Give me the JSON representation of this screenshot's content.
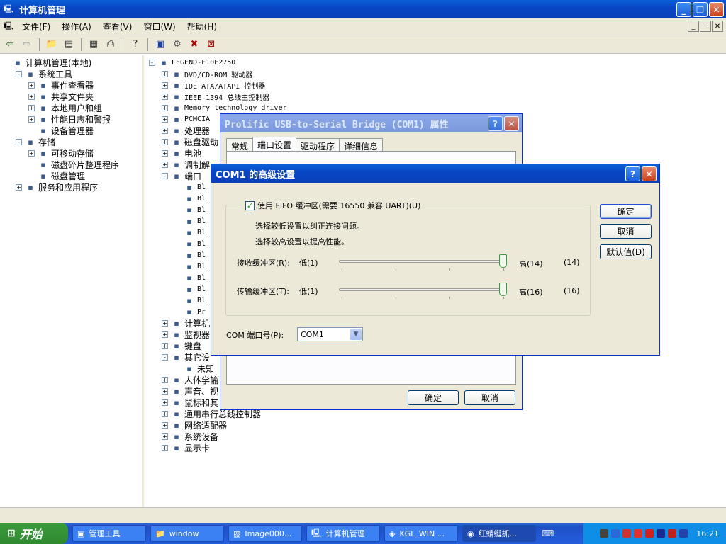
{
  "window": {
    "title": "计算机管理"
  },
  "menu": [
    "文件(F)",
    "操作(A)",
    "查看(V)",
    "窗口(W)",
    "帮助(H)"
  ],
  "left_tree": [
    {
      "label": "计算机管理(本地)",
      "depth": 0,
      "exp": ""
    },
    {
      "label": "系统工具",
      "depth": 1,
      "exp": "-"
    },
    {
      "label": "事件查看器",
      "depth": 2,
      "exp": "+"
    },
    {
      "label": "共享文件夹",
      "depth": 2,
      "exp": "+"
    },
    {
      "label": "本地用户和组",
      "depth": 2,
      "exp": "+"
    },
    {
      "label": "性能日志和警报",
      "depth": 2,
      "exp": "+"
    },
    {
      "label": "设备管理器",
      "depth": 2,
      "exp": ""
    },
    {
      "label": "存储",
      "depth": 1,
      "exp": "-"
    },
    {
      "label": "可移动存储",
      "depth": 2,
      "exp": "+"
    },
    {
      "label": "磁盘碎片整理程序",
      "depth": 2,
      "exp": ""
    },
    {
      "label": "磁盘管理",
      "depth": 2,
      "exp": ""
    },
    {
      "label": "服务和应用程序",
      "depth": 1,
      "exp": "+"
    }
  ],
  "right_tree": [
    {
      "label": "LEGEND-F10E2750",
      "depth": 0,
      "exp": "-"
    },
    {
      "label": "DVD/CD-ROM 驱动器",
      "depth": 1,
      "exp": "+"
    },
    {
      "label": "IDE ATA/ATAPI 控制器",
      "depth": 1,
      "exp": "+"
    },
    {
      "label": "IEEE 1394 总线主控制器",
      "depth": 1,
      "exp": "+"
    },
    {
      "label": "Memory technology driver",
      "depth": 1,
      "exp": "+"
    },
    {
      "label": "PCMCIA",
      "depth": 1,
      "exp": "+"
    },
    {
      "label": "处理器",
      "depth": 1,
      "exp": "+"
    },
    {
      "label": "磁盘驱动",
      "depth": 1,
      "exp": "+"
    },
    {
      "label": "电池",
      "depth": 1,
      "exp": "+"
    },
    {
      "label": "调制解",
      "depth": 1,
      "exp": "+"
    },
    {
      "label": "端口",
      "depth": 1,
      "exp": "-"
    },
    {
      "label": "Bl",
      "depth": 2,
      "exp": ""
    },
    {
      "label": "Bl",
      "depth": 2,
      "exp": ""
    },
    {
      "label": "Bl",
      "depth": 2,
      "exp": ""
    },
    {
      "label": "Bl",
      "depth": 2,
      "exp": ""
    },
    {
      "label": "Bl",
      "depth": 2,
      "exp": ""
    },
    {
      "label": "Bl",
      "depth": 2,
      "exp": ""
    },
    {
      "label": "Bl",
      "depth": 2,
      "exp": ""
    },
    {
      "label": "Bl",
      "depth": 2,
      "exp": ""
    },
    {
      "label": "Bl",
      "depth": 2,
      "exp": ""
    },
    {
      "label": "Bl",
      "depth": 2,
      "exp": ""
    },
    {
      "label": "Bl",
      "depth": 2,
      "exp": ""
    },
    {
      "label": "Pr",
      "depth": 2,
      "exp": ""
    },
    {
      "label": "计算机",
      "depth": 1,
      "exp": "+"
    },
    {
      "label": "监视器",
      "depth": 1,
      "exp": "+"
    },
    {
      "label": "键盘",
      "depth": 1,
      "exp": "+"
    },
    {
      "label": "其它设",
      "depth": 1,
      "exp": "-"
    },
    {
      "label": "未知",
      "depth": 2,
      "exp": ""
    },
    {
      "label": "人体学输",
      "depth": 1,
      "exp": "+"
    },
    {
      "label": "声音、视",
      "depth": 1,
      "exp": "+"
    },
    {
      "label": "鼠标和其",
      "depth": 1,
      "exp": "+"
    },
    {
      "label": "通用串行总线控制器",
      "depth": 1,
      "exp": "+"
    },
    {
      "label": "网络适配器",
      "depth": 1,
      "exp": "+"
    },
    {
      "label": "系统设备",
      "depth": 1,
      "exp": "+"
    },
    {
      "label": "显示卡",
      "depth": 1,
      "exp": "+"
    }
  ],
  "props_dialog": {
    "title": "Prolific USB-to-Serial Bridge (COM1) 属性",
    "tabs": [
      "常规",
      "端口设置",
      "驱动程序",
      "详细信息"
    ],
    "ok": "确定",
    "cancel": "取消"
  },
  "adv_dialog": {
    "title": "COM1 的高级设置",
    "fifo_label": "使用 FIFO 缓冲区(需要 16550 兼容 UART)(U)",
    "fifo_checked": true,
    "hint1": "选择较低设置以纠正连接问题。",
    "hint2": "选择较高设置以提高性能。",
    "rx_label": "接收缓冲区(R):",
    "rx_low": "低(1)",
    "rx_high": "高(14)",
    "rx_value": "(14)",
    "rx_level": 1.0,
    "tx_label": "传输缓冲区(T):",
    "tx_low": "低(1)",
    "tx_high": "高(16)",
    "tx_value": "(16)",
    "tx_level": 1.0,
    "com_label": "COM 端口号(P):",
    "com_value": "COM1",
    "ok": "确定",
    "cancel": "取消",
    "defaults": "默认值(D)"
  },
  "taskbar": {
    "start": "开始",
    "tasks": [
      "管理工具",
      "window",
      "Image000...",
      "计算机管理",
      "KGL_WIN ...",
      "红蜻蜓抓..."
    ],
    "clock": "16:21"
  }
}
